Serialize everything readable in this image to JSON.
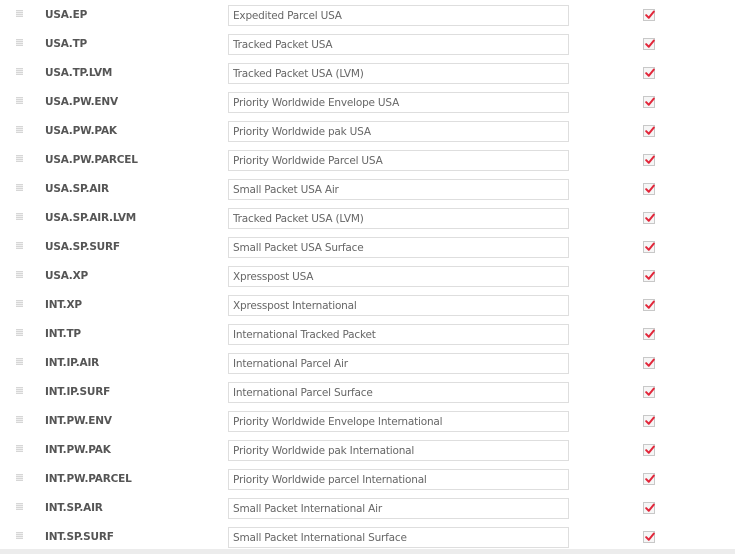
{
  "accent_check_color": "#e2263a",
  "services": [
    {
      "code": "USA.EP",
      "name": "Expedited Parcel USA",
      "enabled": true
    },
    {
      "code": "USA.TP",
      "name": "Tracked Packet USA",
      "enabled": true
    },
    {
      "code": "USA.TP.LVM",
      "name": "Tracked Packet USA (LVM)",
      "enabled": true
    },
    {
      "code": "USA.PW.ENV",
      "name": "Priority Worldwide Envelope USA",
      "enabled": true
    },
    {
      "code": "USA.PW.PAK",
      "name": "Priority Worldwide pak USA",
      "enabled": true
    },
    {
      "code": "USA.PW.PARCEL",
      "name": "Priority Worldwide Parcel USA",
      "enabled": true
    },
    {
      "code": "USA.SP.AIR",
      "name": "Small Packet USA Air",
      "enabled": true
    },
    {
      "code": "USA.SP.AIR.LVM",
      "name": "Tracked Packet USA (LVM)",
      "enabled": true
    },
    {
      "code": "USA.SP.SURF",
      "name": "Small Packet USA Surface",
      "enabled": true
    },
    {
      "code": "USA.XP",
      "name": "Xpresspost USA",
      "enabled": true
    },
    {
      "code": "INT.XP",
      "name": "Xpresspost International",
      "enabled": true
    },
    {
      "code": "INT.TP",
      "name": "International Tracked Packet",
      "enabled": true
    },
    {
      "code": "INT.IP.AIR",
      "name": "International Parcel Air",
      "enabled": true
    },
    {
      "code": "INT.IP.SURF",
      "name": "International Parcel Surface",
      "enabled": true
    },
    {
      "code": "INT.PW.ENV",
      "name": "Priority Worldwide Envelope International",
      "enabled": true
    },
    {
      "code": "INT.PW.PAK",
      "name": "Priority Worldwide pak International",
      "enabled": true
    },
    {
      "code": "INT.PW.PARCEL",
      "name": "Priority Worldwide parcel International",
      "enabled": true
    },
    {
      "code": "INT.SP.AIR",
      "name": "Small Packet International Air",
      "enabled": true
    },
    {
      "code": "INT.SP.SURF",
      "name": "Small Packet International Surface",
      "enabled": true
    }
  ]
}
